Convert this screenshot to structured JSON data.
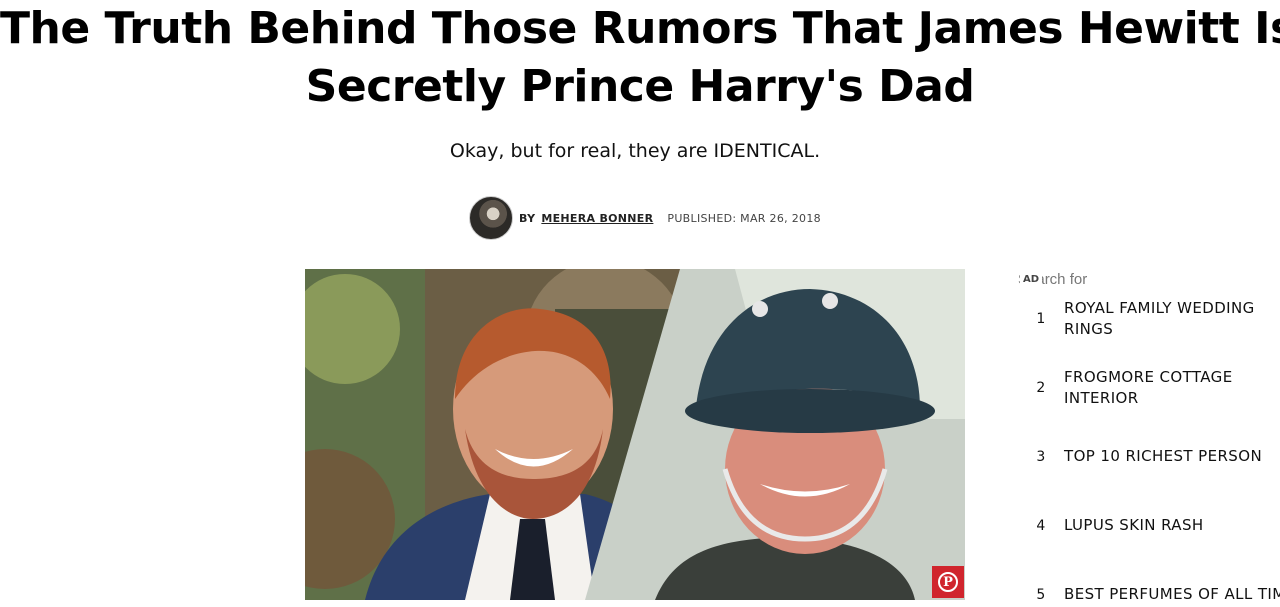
{
  "article": {
    "headline_line1": "The Truth Behind Those Rumors That James Hewitt Is",
    "headline_line2": "Secretly Prince Harry's Dad",
    "dek": "Okay, but for real, they are IDENTICAL.",
    "byline_prefix": "BY",
    "author": "MEHERA BONNER",
    "published": "PUBLISHED: MAR 26, 2018"
  },
  "hero": {
    "pin_icon": "pinterest-icon",
    "pin_color": "#d0252d"
  },
  "ad": {
    "badge": "AD",
    "search_label": "Search for",
    "items": [
      {
        "num": "1",
        "label": "ROYAL FAMILY WEDDING RINGS"
      },
      {
        "num": "2",
        "label": "FROGMORE COTTAGE INTERIOR"
      },
      {
        "num": "3",
        "label": "TOP 10 RICHEST PERSON"
      },
      {
        "num": "4",
        "label": "LUPUS SKIN RASH"
      },
      {
        "num": "5",
        "label": "BEST PERFUMES OF ALL TIME"
      }
    ]
  }
}
